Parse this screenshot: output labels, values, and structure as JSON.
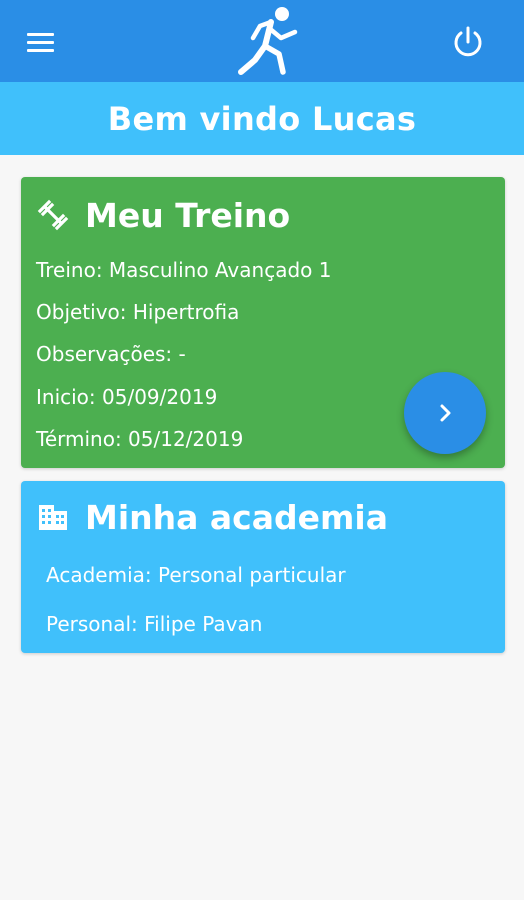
{
  "appbar": {
    "menu_icon": "hamburger-menu-icon",
    "logo_icon": "runner-icon",
    "power_icon": "power-icon",
    "background": "#2a8ee6"
  },
  "welcome": {
    "text": "Bem vindo Lucas",
    "background": "#40c0fb"
  },
  "treino_card": {
    "title": "Meu Treino",
    "icon": "fitness-dumbbell-icon",
    "background": "#4caf50",
    "fields": [
      "Treino: Masculino Avançado 1",
      "Objetivo: Hipertrofia",
      "Observações: -",
      "Inicio: 05/09/2019",
      "Término: 05/12/2019"
    ],
    "open_button_icon": "chevron-right-icon"
  },
  "academia_card": {
    "title": "Minha academia",
    "icon": "building-icon",
    "background": "#40c0fb",
    "fields": [
      "Academia: Personal particular",
      "Personal: Filipe Pavan"
    ]
  }
}
